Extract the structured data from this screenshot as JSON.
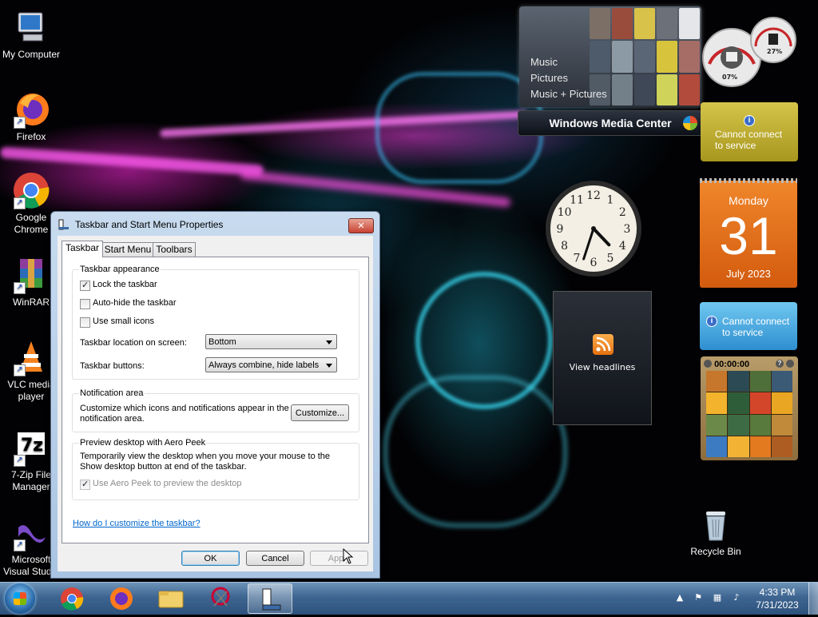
{
  "desktop_icons": [
    {
      "label": "My Computer"
    },
    {
      "label": "Firefox"
    },
    {
      "label": "Google Chrome"
    },
    {
      "label": "WinRAR"
    },
    {
      "label": "VLC media player"
    },
    {
      "label": "7-Zip File Manager"
    },
    {
      "label": "Microsoft Visual Studio"
    },
    {
      "label": "Recycle Bin"
    }
  ],
  "gadgets": {
    "media_center": {
      "menu": [
        "Music",
        "Pictures",
        "Music + Pictures"
      ],
      "bar_title": "Windows Media Center"
    },
    "cpu_meter": {
      "cpu": "07%",
      "memory": "27%"
    },
    "weather_top": {
      "message": "Cannot connect to service"
    },
    "calendar": {
      "weekday": "Monday",
      "day": "31",
      "month_year": "July 2023"
    },
    "weather_bottom": {
      "message": "Cannot connect to service"
    },
    "feed": {
      "label": "View headlines"
    },
    "puzzle": {
      "timer": "00:00:00"
    },
    "clock": {
      "hour": 4,
      "minute": 33,
      "numerals": [
        "12",
        "1",
        "2",
        "3",
        "4",
        "5",
        "6",
        "7",
        "8",
        "9",
        "10",
        "11"
      ]
    }
  },
  "dialog": {
    "title": "Taskbar and Start Menu Properties",
    "close_glyph": "✕",
    "tabs": [
      "Taskbar",
      "Start Menu",
      "Toolbars"
    ],
    "active_tab": "Taskbar",
    "appearance": {
      "title": "Taskbar appearance",
      "lock_label": "Lock the taskbar",
      "lock_checked": true,
      "autohide_label": "Auto-hide the taskbar",
      "autohide_checked": false,
      "small_icons_label": "Use small icons",
      "small_icons_checked": false,
      "location_label": "Taskbar location on screen:",
      "location_value": "Bottom",
      "buttons_label": "Taskbar buttons:",
      "buttons_value": "Always combine, hide labels"
    },
    "notification": {
      "title": "Notification area",
      "text_line1": "Customize which icons and notifications appear in the",
      "text_line2": "notification area.",
      "customize_button": "Customize..."
    },
    "aero_peek": {
      "title": "Preview desktop with Aero Peek",
      "text_line1": "Temporarily view the desktop when you move your mouse to the",
      "text_line2": "Show desktop button at end of the taskbar.",
      "checkbox_label": "Use Aero Peek to preview the desktop",
      "checkbox_checked": true,
      "checkbox_disabled": true
    },
    "help_link": "How do I customize the taskbar?",
    "ok_button": "OK",
    "cancel_button": "Cancel",
    "apply_button": "Apply"
  },
  "taskbar": {
    "pinned": [
      "chrome-icon",
      "firefox-icon",
      "explorer-icon",
      "snipping-tool-icon",
      "taskbar-properties-icon"
    ],
    "clock_time": "4:33 PM",
    "clock_date": "7/31/2023",
    "tray_icons": [
      "show-hidden-icons-chevron",
      "action-center-icon",
      "network-icon",
      "volume-muted-icon"
    ]
  },
  "colors": {
    "calendar_orange": "#e16c1a",
    "weather_yellow": "#c4b236",
    "weather_blue": "#4aa6e0",
    "taskbar_blue": "#3e6591"
  }
}
